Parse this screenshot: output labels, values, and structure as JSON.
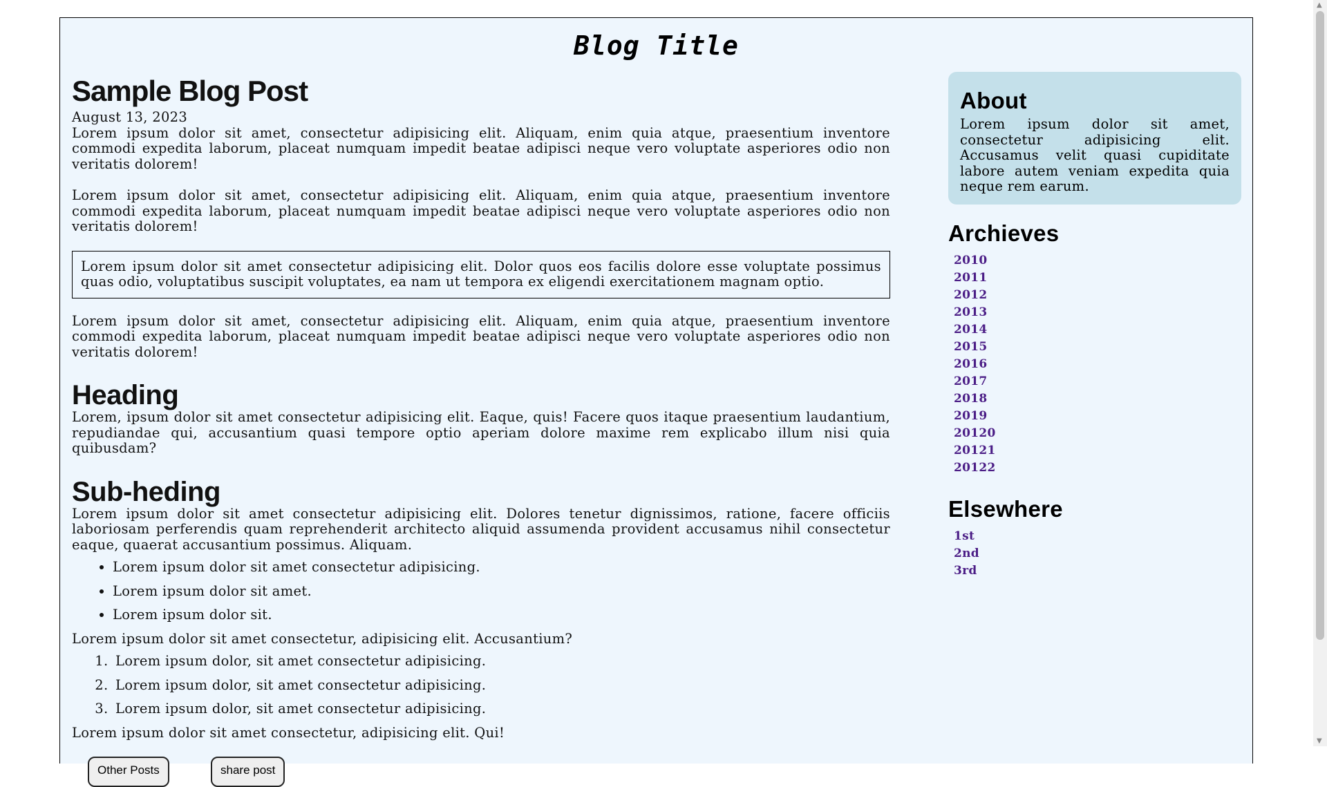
{
  "header": {
    "blog_title": "Blog Title"
  },
  "post": {
    "title": "Sample Blog Post",
    "date": "August 13, 2023",
    "paragraphs": [
      "Lorem ipsum dolor sit amet, consectetur adipisicing elit. Aliquam, enim quia atque, praesentium inventore commodi expedita laborum, placeat numquam impedit beatae adipisci neque vero voluptate asperiores odio non veritatis dolorem!",
      "Lorem ipsum dolor sit amet, consectetur adipisicing elit. Aliquam, enim quia atque, praesentium inventore commodi expedita laborum, placeat numquam impedit beatae adipisci neque vero voluptate asperiores odio non veritatis dolorem!",
      "Lorem ipsum dolor sit amet, consectetur adipisicing elit. Aliquam, enim quia atque, praesentium inventore commodi expedita laborum, placeat numquam impedit beatae adipisci neque vero voluptate asperiores odio non veritatis dolorem!"
    ],
    "quote": "Lorem ipsum dolor sit amet consectetur adipisicing elit. Dolor quos eos facilis dolore esse voluptate possimus quas odio, voluptatibus suscipit voluptates, ea nam ut tempora ex eligendi exercitationem magnam optio.",
    "heading": "Heading",
    "heading_text": "Lorem, ipsum dolor sit amet consectetur adipisicing elit. Eaque, quis! Facere quos itaque praesentium laudantium, repudiandae qui, accusantium quasi tempore optio aperiam dolore maxime rem explicabo illum nisi quia quibusdam?",
    "subheading": "Sub-heding",
    "subheading_text": "Lorem ipsum dolor sit amet consectetur adipisicing elit. Dolores tenetur dignissimos, ratione, facere officiis laboriosam perferendis quam reprehenderit architecto aliquid assumenda provident accusamus nihil consectetur eaque, quaerat accusantium possimus. Aliquam.",
    "bullets": [
      "Lorem ipsum dolor sit amet consectetur adipisicing.",
      "Lorem ipsum dolor sit amet.",
      "Lorem ipsum dolor sit."
    ],
    "between_lists": "Lorem ipsum dolor sit amet consectetur, adipisicing elit. Accusantium?",
    "numbered": [
      "Lorem ipsum dolor, sit amet consectetur adipisicing.",
      "Lorem ipsum dolor, sit amet consectetur adipisicing.",
      "Lorem ipsum dolor, sit amet consectetur adipisicing."
    ],
    "closing": "Lorem ipsum dolor sit amet consectetur, adipisicing elit. Qui!",
    "buttons": {
      "other_posts": "Other Posts",
      "share_post": "share post"
    }
  },
  "sidebar": {
    "about": {
      "title": "About",
      "text": "Lorem ipsum dolor sit amet, consectetur adipisicing elit. Accusamus velit quasi cupiditate labore autem veniam expedita quia neque rem earum."
    },
    "archives": {
      "title": "Archieves",
      "links": [
        "2010",
        "2011",
        "2012",
        "2013",
        "2014",
        "2015",
        "2016",
        "2017",
        "2018",
        "2019",
        "20120",
        "20121",
        "20122"
      ]
    },
    "elsewhere": {
      "title": "Elsewhere",
      "links": [
        "1st",
        "2nd",
        "3rd"
      ]
    }
  },
  "colors": {
    "page_background": "#eef6fd",
    "about_background": "#c4e0ea",
    "link": "#4b1d86"
  }
}
